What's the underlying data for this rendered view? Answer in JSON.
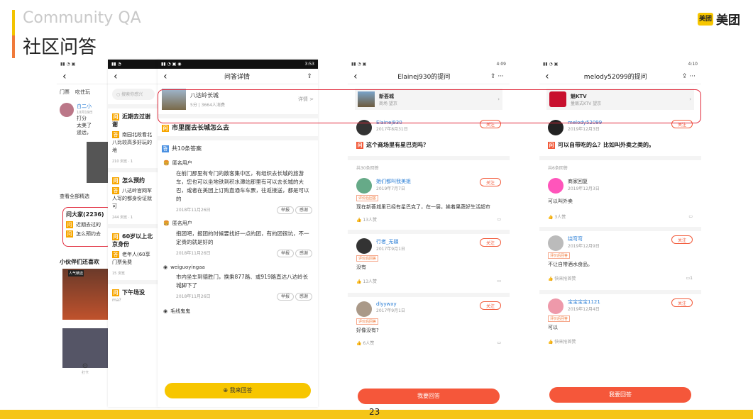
{
  "header": {
    "title_en": "Community QA",
    "title_cn": "社区问答",
    "brand_logo": "美团",
    "brand_name": "美团"
  },
  "page_number": "23",
  "p1": {
    "tabs": [
      "门票",
      "吃住玩"
    ],
    "user": "白二小",
    "date": "10月19日",
    "text1": "打分",
    "text2": "太美了",
    "text3": "遥远，",
    "see_all": "查看全部精选",
    "qa_title": "问大家(2236)",
    "q1": "近期去过的",
    "q2": "怎么预约去",
    "section": "小伙伴们还喜欢",
    "badge": "人气精选",
    "bottom_label": "打卡"
  },
  "p2": {
    "search_placeholder": "搜索你感兴",
    "items": [
      {
        "q": "近期去过谢谢",
        "a": "南园北段看北八比较高多好玩的地",
        "meta": "210 浏览 · 1"
      },
      {
        "q": "怎么预约",
        "a": "八达岭官网军人写的都身份证就可",
        "meta": "244 浏览 · 1"
      },
      {
        "q": "60岁以上北京身份",
        "a": "老年人(60享门票免费",
        "meta": "15 浏览"
      },
      {
        "q": "下午场没",
        "a": "ma?"
      }
    ]
  },
  "p3": {
    "status_time": "3:53",
    "nav_title": "问答详情",
    "place_name": "八达岭长城",
    "place_meta": "5分 | 3664人消费",
    "place_link": "详情 >",
    "question": "市里面去长城怎么去",
    "answer_count": "共10条答案",
    "answers": [
      {
        "user": "匿名用户",
        "text": "在前门那里有专门的散客集中区，有组织去长城的旅游车，您也可以坐地铁到积水潭站那里有可以去长城的大巴，或者在美团上订购直通车车票，往返接送，都是可以的",
        "date": "2018年11月26日",
        "report": "举报",
        "thanks": "感谢"
      },
      {
        "user": "匿名用户",
        "text": "抱团吧，报团的时候要找好一点的团，有的团很坑，不一定贵的就是好的",
        "date": "2018年11月26日",
        "report": "举报",
        "thanks": "感谢"
      },
      {
        "user": "weiguoyingaa",
        "text": "市内坐车到德胜门，换乘877路、或919路直达八达岭长城脚下了",
        "date": "2018年11月26日",
        "report": "举报",
        "thanks": "感谢"
      },
      {
        "user": "毛线鬼鬼",
        "text": ""
      }
    ],
    "button": "我来回答"
  },
  "p4": {
    "status_time": "4:09",
    "nav_title": "Elainej930的提问",
    "shop_name": "新荟城",
    "shop_meta": "商场 望京",
    "asker": "Elainej930",
    "asker_date": "2017年8月31日",
    "question": "这个商场里有星巴克吗？",
    "follow": "关注",
    "answer_count": "共30条回答",
    "answers": [
      {
        "user": "她们都叫我美姐",
        "date": "2019年7月7日",
        "tag": "评价后回答",
        "text": "现在新荟城里已经有星巴克了，在一层，挨着果蔬好生活超市",
        "likes": "13人赞"
      },
      {
        "user": "行者_无疆",
        "date": "2017年9月1日",
        "tag": "评价后回答",
        "text": "没有",
        "likes": "13人赞"
      },
      {
        "user": "dlyywxy",
        "date": "2017年9月1日",
        "tag": "评价后回答",
        "text": "好像没有?",
        "likes": "6人赞"
      }
    ],
    "button": "我要回答"
  },
  "p5": {
    "status_time": "4:10",
    "nav_title": "melody52099的提问",
    "shop_name": "魅KTV",
    "shop_meta": "量贩式KTV 望京",
    "asker": "melody52099",
    "asker_date": "2019年12月3日",
    "question": "可以自带吃的么？比如叫外卖之类的。",
    "follow": "关注",
    "answer_count": "共6条回答",
    "answers": [
      {
        "user": "商家回复",
        "date": "2019年12月3日",
        "tag": "",
        "text": "可以叫外卖",
        "likes": "3人赞"
      },
      {
        "user": "绕弯弯",
        "date": "2019年12月9日",
        "tag": "评价后回答",
        "text": "不让自带酒水食品。",
        "likes": "快来抢首赞",
        "comments": "1"
      },
      {
        "user": "宝宝宝宝1121",
        "date": "2019年12月4日",
        "tag": "评价后回答",
        "text": "可以",
        "likes": "快来抢首赞"
      }
    ],
    "button": "我要回答"
  }
}
